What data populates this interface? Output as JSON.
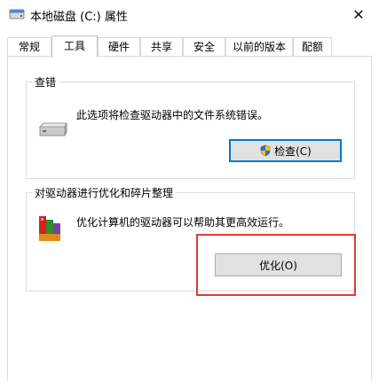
{
  "window": {
    "title": "本地磁盘 (C:) 属性",
    "close_glyph": "✕"
  },
  "tabs": [
    {
      "label": "常规",
      "active": false
    },
    {
      "label": "工具",
      "active": true
    },
    {
      "label": "硬件",
      "active": false
    },
    {
      "label": "共享",
      "active": false
    },
    {
      "label": "安全",
      "active": false
    },
    {
      "label": "以前的版本",
      "active": false
    },
    {
      "label": "配额",
      "active": false
    }
  ],
  "error_check": {
    "title": "查错",
    "description": "此选项将检查驱动器中的文件系统错误。",
    "button_label": "检查(C)",
    "icon": "drive-icon"
  },
  "optimize": {
    "title": "对驱动器进行优化和碎片整理",
    "description": "优化计算机的驱动器可以帮助其更高效运行。",
    "button_label": "优化(O)",
    "icon": "defrag-icon"
  },
  "colors": {
    "accent": "#0078d7",
    "highlight": "#e53935",
    "button_bg": "#e1e1e1"
  }
}
